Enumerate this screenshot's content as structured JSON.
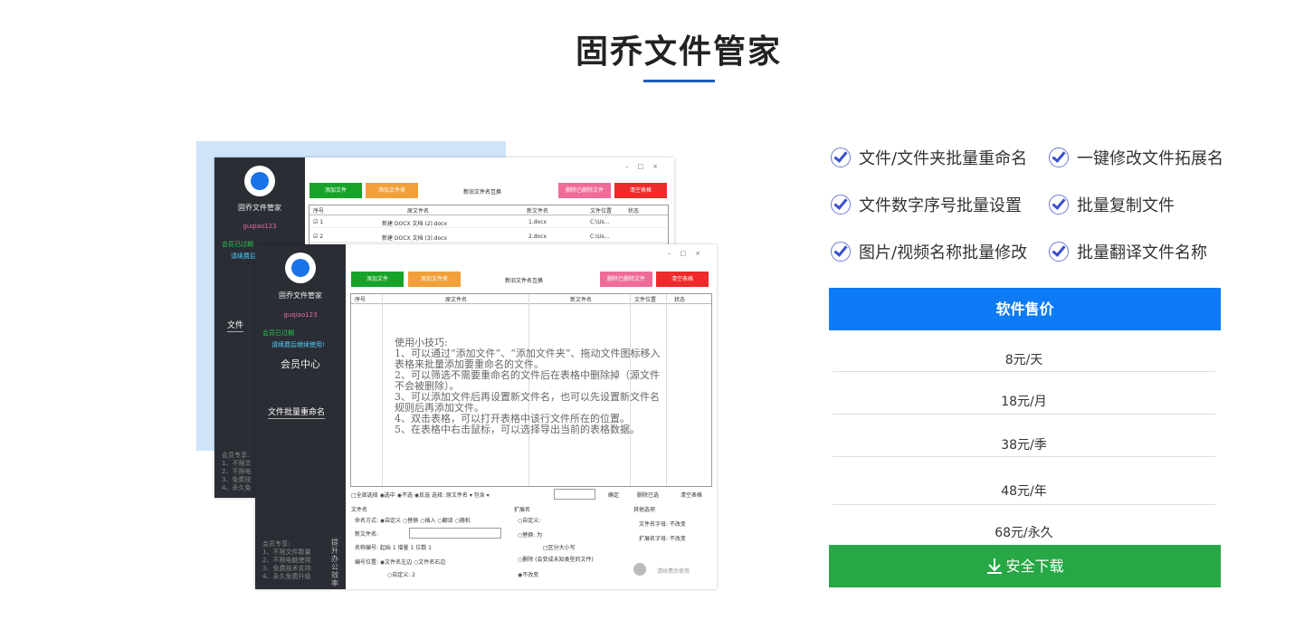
{
  "header": {
    "title": "固乔文件管家"
  },
  "screenshot": {
    "app_name": "固乔文件管家",
    "user": "guqiao123",
    "member_status": "会员已过期",
    "renew_hint": "请续费后继续使用!",
    "renew_hint_short": "请续费后",
    "member_center": "会员中心",
    "menu_item": "文件批量重命名",
    "menu_item_short": "文件",
    "footer_title": "会员专享:",
    "footer_lines": [
      "1、不限文件数量",
      "2、不限电脑使用",
      "3、免费技术支持",
      "4、永久免费升级"
    ],
    "footer_lines_short": [
      "1、不限文",
      "2、不限电",
      "3、免费技",
      "4、永久免"
    ],
    "side_vertical": "提升办公效率",
    "buttons": {
      "add_file": "添加文件",
      "add_folder": "添加文件夹",
      "swap": "新旧文件名互换",
      "delete_done": "删除已删除文件",
      "clear": "清空表格"
    },
    "columns": {
      "no": "序号",
      "old": "原文件名",
      "new": "新文件名",
      "loc": "文件位置",
      "status": "状态"
    },
    "rows": [
      {
        "no": "1",
        "old": "新建 DOCX 文档 (2).docx",
        "new": "1.docx",
        "loc": "C:\\Us..."
      },
      {
        "no": "2",
        "old": "新建 DOCX 文档 (3).docx",
        "new": "2.docx",
        "loc": "C:\\Us..."
      }
    ],
    "tips": "使用小技巧:\n1、可以通过“添加文件”、“添加文件夹”、拖动文件图标移入表格来批量添加要重命名的文件。\n2、可以筛选不需要重命名的文件后在表格中删除掉（源文件不会被删除）。\n3、可以添加文件后再设置新文件名，也可以先设置新文件名规则后再添加文件。\n4、双击表格，可以打开表格中该行文件所在的位置。\n5、在表格中右击鼠标，可以选择导出当前的表格数据。",
    "bottom_bar": "□全部选择  ◉选中  ◉不选  ◉反选  选择: 原文件名 ▾  包含 ▾",
    "bottom_confirm": "确定",
    "bottom_delete": "删除已选",
    "bottom_clear": "清空表格",
    "file_name": "文件名",
    "naming_mode": "命名方式: ◉自定义 ○替换 ○插入 ○翻译 ○随机",
    "new_file_name": "新文件名:",
    "numbering": "名称编号: 起始 1  增量 1  位数 1",
    "number_pos": "编号位置: ◉文件名左边  ○文件名右边",
    "custom_pos": "○自定义: 2",
    "ext": "扩展名",
    "ext_custom": "○自定义:",
    "ext_replace": "○替换:          为",
    "case_sensitive": "□区分大小写",
    "ext_delete": "○删除 (会变成未知类型的文件)",
    "ext_keep": "◉不改变",
    "other": "其他选项",
    "fname_case": "文件名字母: 不改变",
    "ext_case": "扩展名字母: 不改变",
    "renew_btn": "请续费后使用"
  },
  "features": [
    "文件/文件夹批量重命名",
    "一键修改文件拓展名",
    "文件数字序号批量设置",
    "批量复制文件",
    "图片/视频名称批量修改",
    "批量翻译文件名称"
  ],
  "pricing": {
    "header": "软件售价",
    "items": [
      "8元/天",
      "18元/月",
      "38元/季",
      "48元/年",
      "68元/永久"
    ]
  },
  "download": {
    "label": "安全下载"
  },
  "colors": {
    "accent": "#0d7bf5",
    "download": "#28a745",
    "title_line": "#1e5bb8"
  }
}
